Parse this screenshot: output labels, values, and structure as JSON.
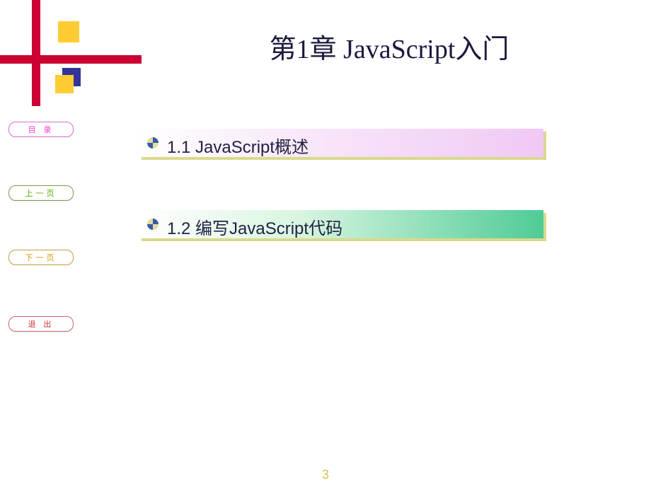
{
  "title": "第1章  JavaScript入门",
  "nav": {
    "toc": "目  录",
    "prev": "上一页",
    "next": "下一页",
    "exit": "退  出"
  },
  "sections": {
    "s1": "1.1  JavaScript概述",
    "s2": "1.2  编写JavaScript代码"
  },
  "page_number": "3"
}
